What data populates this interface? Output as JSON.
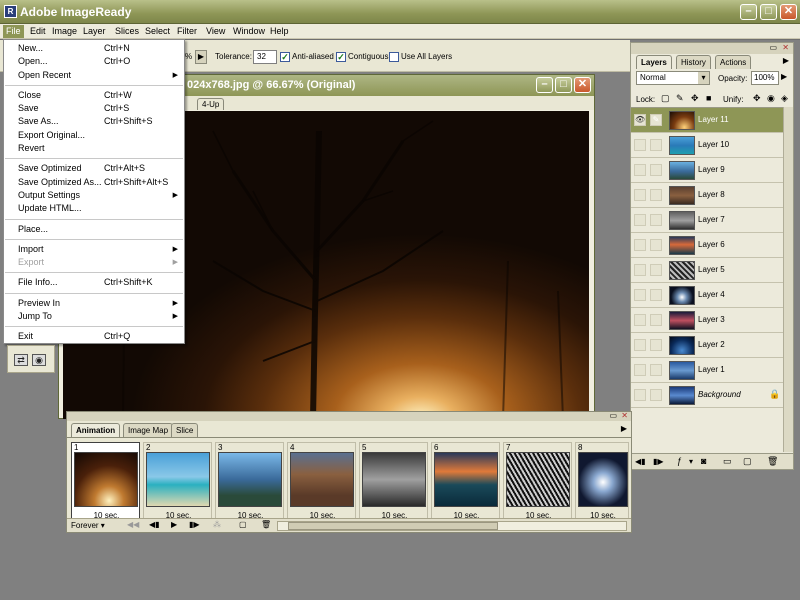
{
  "app": {
    "title": "Adobe ImageReady",
    "window_controls": [
      "minimize",
      "maximize",
      "close"
    ]
  },
  "menubar": {
    "items": [
      "File",
      "Edit",
      "Image",
      "Layer",
      "Slices",
      "Select",
      "Filter",
      "View",
      "Window",
      "Help"
    ]
  },
  "options": {
    "tolerance_label": "Tolerance:",
    "tolerance_value": "32",
    "opacity_frag": "%",
    "anti_aliased": "Anti-aliased",
    "contiguous": "Contiguous",
    "use_all_layers": "Use All Layers"
  },
  "document": {
    "title": "024x768.jpg @ 66.67% (Original)",
    "tabs": [
      "4-Up"
    ]
  },
  "file_menu": {
    "groups": [
      [
        {
          "label": "New...",
          "shortcut": "Ctrl+N"
        },
        {
          "label": "Open...",
          "shortcut": "Ctrl+O"
        },
        {
          "label": "Open Recent",
          "submenu": true
        }
      ],
      [
        {
          "label": "Close",
          "shortcut": "Ctrl+W"
        },
        {
          "label": "Save",
          "shortcut": "Ctrl+S"
        },
        {
          "label": "Save As...",
          "shortcut": "Ctrl+Shift+S"
        },
        {
          "label": "Export Original..."
        },
        {
          "label": "Revert"
        }
      ],
      [
        {
          "label": "Save Optimized",
          "shortcut": "Ctrl+Alt+S"
        },
        {
          "label": "Save Optimized As...",
          "shortcut": "Ctrl+Shift+Alt+S"
        },
        {
          "label": "Output Settings",
          "submenu": true
        },
        {
          "label": "Update HTML..."
        }
      ],
      [
        {
          "label": "Place..."
        }
      ],
      [
        {
          "label": "Import",
          "submenu": true
        },
        {
          "label": "Export",
          "submenu": true,
          "disabled": true
        }
      ],
      [
        {
          "label": "File Info...",
          "shortcut": "Ctrl+Shift+K"
        }
      ],
      [
        {
          "label": "Preview In",
          "submenu": true
        },
        {
          "label": "Jump To",
          "submenu": true
        }
      ],
      [
        {
          "label": "Exit",
          "shortcut": "Ctrl+Q"
        }
      ]
    ]
  },
  "layers_panel": {
    "tabs": [
      "Layers",
      "History",
      "Actions"
    ],
    "blend_mode": "Normal",
    "opacity_label": "Opacity:",
    "opacity_value": "100%",
    "lock_label": "Lock:",
    "unify_label": "Unify:",
    "layers": [
      {
        "name": "Layer 11",
        "selected": true,
        "visible": true
      },
      {
        "name": "Layer 10"
      },
      {
        "name": "Layer 9"
      },
      {
        "name": "Layer 8"
      },
      {
        "name": "Layer 7"
      },
      {
        "name": "Layer 6"
      },
      {
        "name": "Layer 5"
      },
      {
        "name": "Layer 4"
      },
      {
        "name": "Layer 3"
      },
      {
        "name": "Layer 2"
      },
      {
        "name": "Layer 1"
      },
      {
        "name": "Background",
        "locked": true
      }
    ]
  },
  "animation": {
    "tabs": [
      "Animation",
      "Image Map",
      "Slice"
    ],
    "frames": [
      {
        "num": "1",
        "duration": "10 sec."
      },
      {
        "num": "2",
        "duration": "10 sec."
      },
      {
        "num": "3",
        "duration": "10 sec."
      },
      {
        "num": "4",
        "duration": "10 sec."
      },
      {
        "num": "5",
        "duration": "10 sec."
      },
      {
        "num": "6",
        "duration": "10 sec."
      },
      {
        "num": "7",
        "duration": "10 sec."
      },
      {
        "num": "8",
        "duration": "10 sec."
      }
    ],
    "loop": "Forever"
  },
  "colors": {
    "accent": "#8e9656",
    "bg": "#808080",
    "panel": "#eceadb"
  }
}
